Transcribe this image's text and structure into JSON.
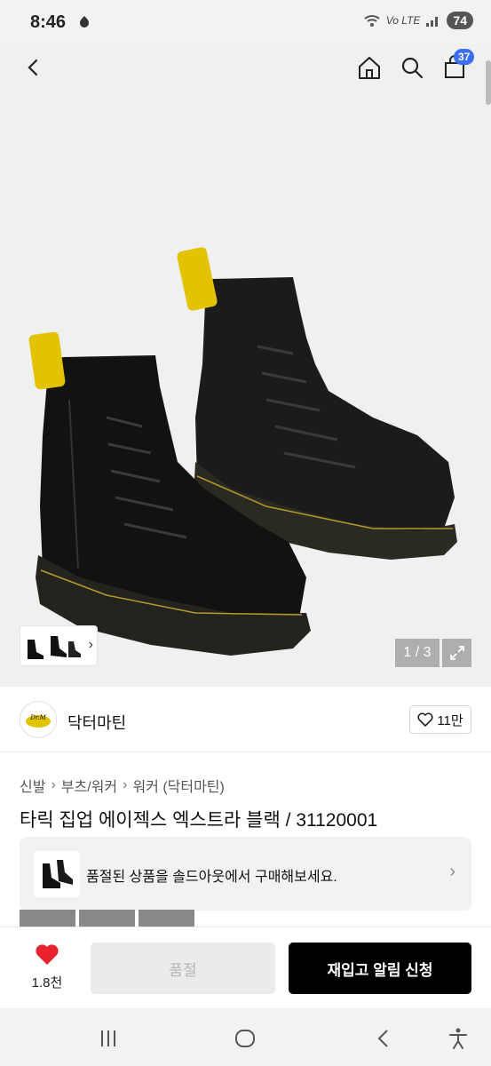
{
  "status_bar": {
    "time": "8:46",
    "network": "Vo LTE",
    "battery": "74"
  },
  "nav": {
    "cart_count": "37"
  },
  "gallery": {
    "page_indicator": "1 / 3"
  },
  "brand": {
    "name": "닥터마틴",
    "like_count": "11만"
  },
  "breadcrumb": [
    "신발",
    "부츠/워커",
    "워커 (닥터마틴)"
  ],
  "product": {
    "title": "타릭 집업 에이젝스 엑스트라 블랙 / 31120001"
  },
  "soldout_banner": {
    "text": "품절된 상품을 솔드아웃에서 구매해보세요."
  },
  "action_bar": {
    "wish_count": "1.8천",
    "soldout_label": "품절",
    "restock_label": "재입고 알림 신청"
  },
  "colors": {
    "accent_badge": "#3b6ef5",
    "heart": "#e8222f",
    "primary_button": "#000000",
    "boot_yellow": "#e3c200"
  }
}
